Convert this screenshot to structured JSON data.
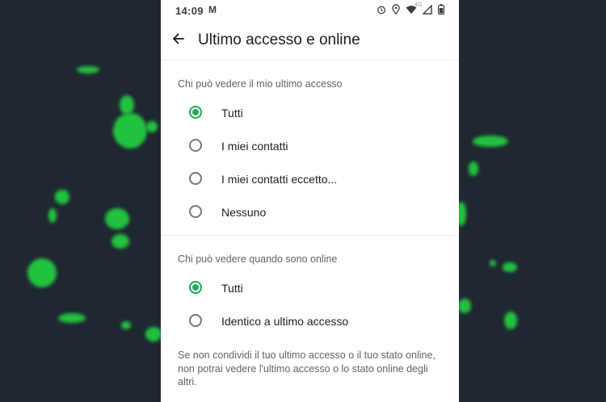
{
  "status_bar": {
    "time": "14:09",
    "gmail_glyph": "M",
    "network": "4G",
    "icons": [
      "alarm-icon",
      "location-icon",
      "wifi-icon",
      "signal-icon",
      "battery-icon"
    ]
  },
  "app_bar": {
    "back_icon": "arrow-left-icon",
    "title": "Ultimo accesso e online"
  },
  "last_seen": {
    "heading": "Chi può vedere il mio ultimo accesso",
    "options": [
      {
        "label": "Tutti",
        "selected": true
      },
      {
        "label": "I miei contatti",
        "selected": false
      },
      {
        "label": "I miei contatti eccetto...",
        "selected": false
      },
      {
        "label": "Nessuno",
        "selected": false
      }
    ]
  },
  "online": {
    "heading": "Chi può vedere quando sono online",
    "options": [
      {
        "label": "Tutti",
        "selected": true
      },
      {
        "label": "Identico a ultimo accesso",
        "selected": false
      }
    ]
  },
  "footnote": "Se non condividi il tuo ultimo accesso o il tuo stato online, non potrai vedere l'ultimo accesso o lo stato online degli altri.",
  "colors": {
    "accent": "#1fa855",
    "background": "#1f2731",
    "blob": "#22c241"
  }
}
